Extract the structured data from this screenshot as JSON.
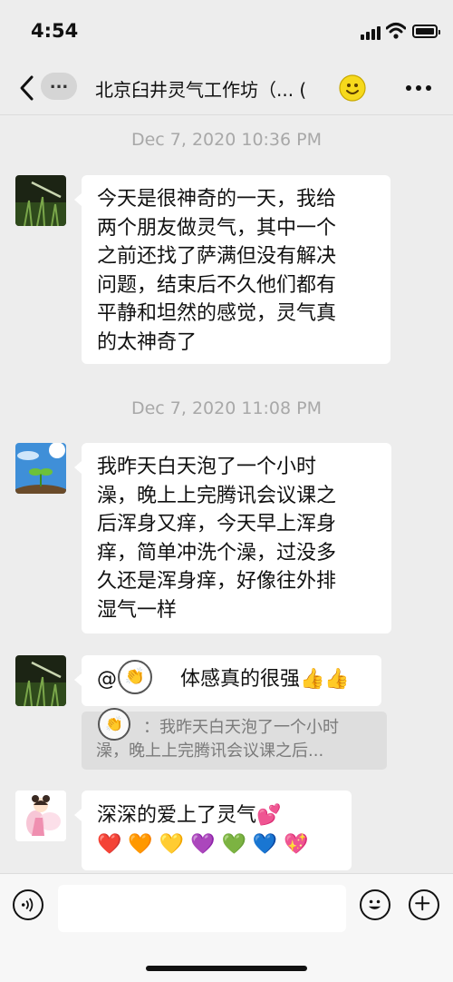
{
  "status": {
    "time": "4:54"
  },
  "header": {
    "title": "北京臼井灵气工作坊（... (",
    "more_label": "...",
    "back_pill": "..."
  },
  "messages": [
    {
      "timestamp": "Dec 7, 2020 10:36 PM",
      "lines": [
        "今天是很神奇的一天，我给",
        "两个朋友做灵气，其中一个",
        "之前还找了萨满但没有解决",
        "问题，结束后不久他们都有",
        "平静和坦然的感觉，灵气真",
        "的太神奇了"
      ]
    },
    {
      "timestamp": "Dec 7, 2020 11:08 PM",
      "lines": [
        "我昨天白天泡了一个小时",
        "澡，晚上上完腾讯会议课之",
        "后浑身又痒，今天早上浑身",
        "痒，简单冲洗个澡，过没多",
        "久还是浑身痒，好像往外排",
        "湿气一样"
      ]
    },
    {
      "mention_prefix": "@",
      "text": "体感真的很强👍👍",
      "quote_lines": [
        "：我昨天白天泡了一个小时",
        "澡，晚上上完腾讯会议课之后..."
      ]
    },
    {
      "lines": [
        "深深的爱上了灵气💕",
        "❤️ 🧡 💛 💜 💚 💙 💖"
      ]
    }
  ],
  "icons": {
    "clap": "clapping-hands-icon"
  }
}
